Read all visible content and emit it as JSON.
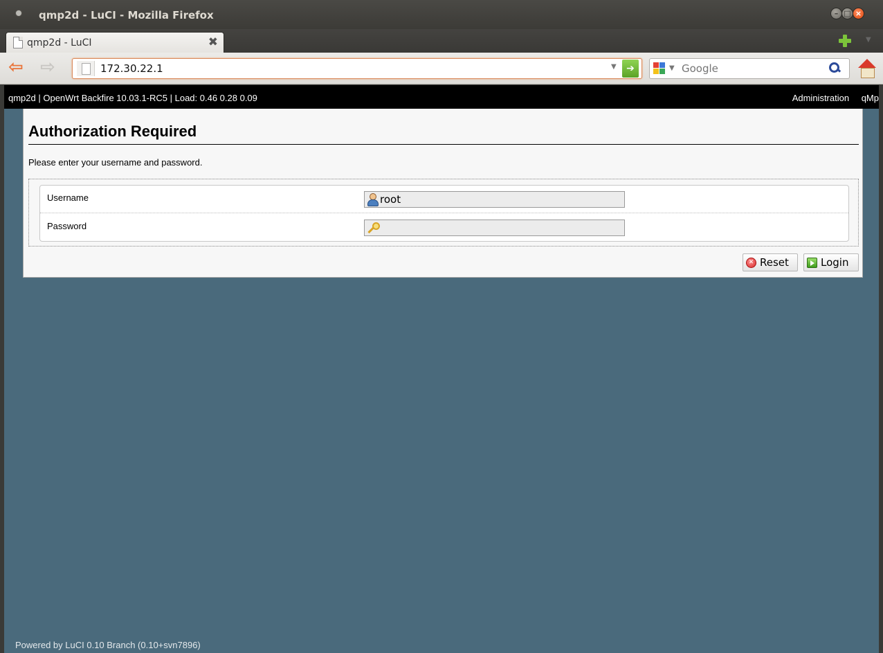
{
  "window": {
    "title": "qmp2d - LuCI - Mozilla Firefox"
  },
  "tab": {
    "label": "qmp2d - LuCI"
  },
  "toolbar": {
    "url": "172.30.22.1",
    "search_placeholder": "Google"
  },
  "header": {
    "info": "qmp2d | OpenWrt Backfire 10.03.1-RC5 | Load: 0.46 0.28 0.09",
    "nav": [
      "Administration",
      "qMp"
    ]
  },
  "login": {
    "title": "Authorization Required",
    "description": "Please enter your username and password.",
    "username_label": "Username",
    "username_value": "root",
    "password_label": "Password",
    "password_value": "",
    "reset_label": "Reset",
    "login_label": "Login"
  },
  "footer": {
    "text": "Powered by LuCI 0.10 Branch (0.10+svn7896)"
  },
  "colors": {
    "page_background": "#4a6a7c",
    "header_background": "#000000"
  }
}
